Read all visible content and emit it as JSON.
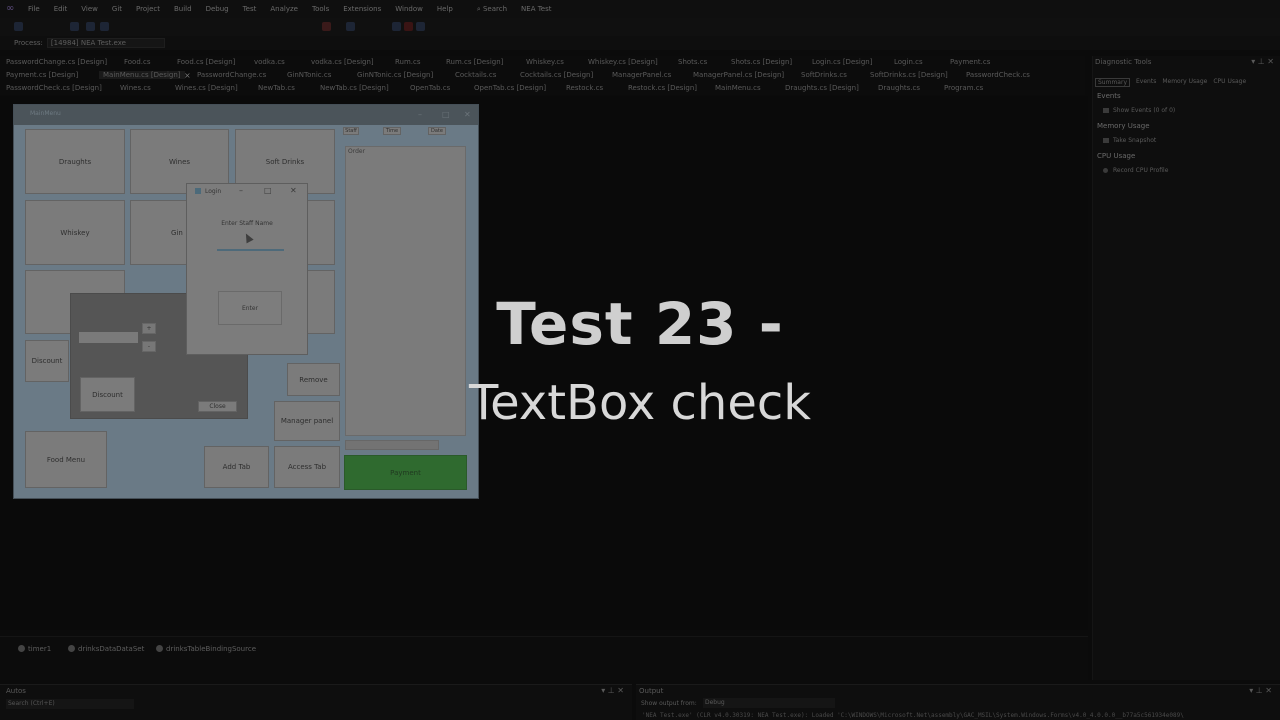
{
  "menubar": {
    "items": [
      "File",
      "Edit",
      "View",
      "Git",
      "Project",
      "Build",
      "Debug",
      "Test",
      "Analyze",
      "Tools",
      "Extensions",
      "Window",
      "Help"
    ],
    "search_label": "Search",
    "solution_name": "NEA Test"
  },
  "process": {
    "label": "Process:",
    "value": "[14984] NEA Test.exe"
  },
  "tabs": {
    "row1": [
      "PasswordChange.cs [Design]",
      "Food.cs",
      "Food.cs [Design]",
      "vodka.cs",
      "vodka.cs [Design]",
      "Rum.cs",
      "Rum.cs [Design]",
      "Whiskey.cs",
      "Whiskey.cs [Design]",
      "Shots.cs",
      "Shots.cs [Design]",
      "Login.cs [Design]",
      "Login.cs",
      "Payment.cs"
    ],
    "row2": [
      "Payment.cs [Design]",
      "MainMenu.cs [Design]",
      "PasswordChange.cs",
      "GinNTonic.cs",
      "GinNTonic.cs [Design]",
      "Cocktails.cs",
      "Cocktails.cs [Design]",
      "ManagerPanel.cs",
      "ManagerPanel.cs [Design]",
      "SoftDrinks.cs",
      "SoftDrinks.cs [Design]",
      "PasswordCheck.cs"
    ],
    "row3": [
      "PasswordCheck.cs [Design]",
      "Wines.cs",
      "Wines.cs [Design]",
      "NewTab.cs",
      "NewTab.cs [Design]",
      "OpenTab.cs",
      "OpenTab.cs [Design]",
      "Restock.cs",
      "Restock.cs [Design]",
      "MainMenu.cs",
      "Draughts.cs [Design]",
      "Draughts.cs",
      "Program.cs"
    ]
  },
  "form": {
    "title": "MainMenu",
    "buttons": {
      "draughts": "Draughts",
      "wines": "Wines",
      "soft_drinks": "Soft Drinks",
      "whiskey": "Whiskey",
      "gin": "Gin",
      "discount_side": "Discount",
      "remove": "Remove",
      "manager_panel": "Manager panel",
      "food_menu": "Food Menu",
      "add_tab": "Add Tab",
      "access_tab": "Access Tab",
      "payment": "Payment",
      "staff": "Staff",
      "time": "Time",
      "date": "Date"
    },
    "order_label": "Order",
    "discount_panel": {
      "discount_button": "Discount",
      "close_button": "Close",
      "plus": "+",
      "minus": "-"
    }
  },
  "login_dialog": {
    "title": "Login",
    "prompt": "Enter Staff Name",
    "enter_button": "Enter"
  },
  "caption": {
    "line1": "Test 23 -",
    "line2": "TextBox check"
  },
  "tray": [
    "timer1",
    "drinksDataDataSet",
    "drinksTableBindingSource"
  ],
  "diagnostics": {
    "title": "Diagnostic Tools",
    "tabs": [
      "Summary",
      "Events",
      "Memory Usage",
      "CPU Usage"
    ],
    "events_header": "Events",
    "show_events": "Show Events (0 of 0)",
    "memory_header": "Memory Usage",
    "take_snapshot": "Take Snapshot",
    "cpu_header": "CPU Usage",
    "record_cpu": "Record CPU Profile"
  },
  "autos": {
    "title": "Autos",
    "search_placeholder": "Search (Ctrl+E)"
  },
  "output": {
    "title": "Output",
    "show_from_label": "Show output from:",
    "show_from_value": "Debug",
    "line": "'NEA Test.exe' (CLR v4.0.30319: NEA Test.exe): Loaded 'C:\\WINDOWS\\Microsoft.Net\\assembly\\GAC_MSIL\\System.Windows.Forms\\v4.0_4.0.0.0__b77a5c561934e089\\"
  }
}
